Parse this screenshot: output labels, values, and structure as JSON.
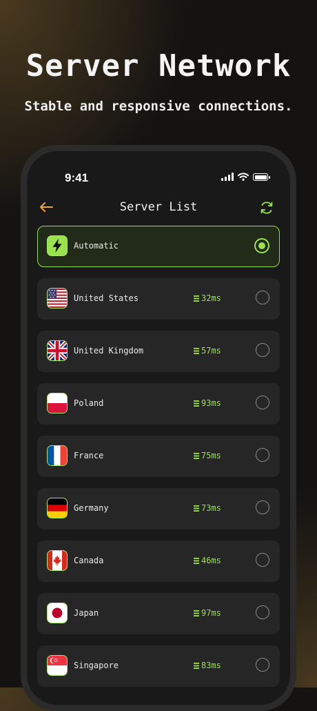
{
  "hero": {
    "title": "Server Network",
    "subtitle": "Stable and responsive connections."
  },
  "status_bar": {
    "time": "9:41"
  },
  "nav": {
    "title": "Server List",
    "back_icon": "arrow-left-icon",
    "refresh_icon": "refresh-icon"
  },
  "colors": {
    "accent": "#9be24f",
    "back_arrow": "#f2a33a",
    "row_bg": "#262626",
    "screen_bg": "#191919"
  },
  "servers": [
    {
      "name": "Automatic",
      "ping": "",
      "selected": true,
      "icon": "lightning-icon"
    },
    {
      "name": "United States",
      "ping": "32ms",
      "selected": false,
      "icon": "us-flag-icon"
    },
    {
      "name": "United Kingdom",
      "ping": "57ms",
      "selected": false,
      "icon": "uk-flag-icon"
    },
    {
      "name": "Poland",
      "ping": "93ms",
      "selected": false,
      "icon": "poland-flag-icon"
    },
    {
      "name": "France",
      "ping": "75ms",
      "selected": false,
      "icon": "france-flag-icon"
    },
    {
      "name": "Germany",
      "ping": "73ms",
      "selected": false,
      "icon": "germany-flag-icon"
    },
    {
      "name": "Canada",
      "ping": "46ms",
      "selected": false,
      "icon": "canada-flag-icon"
    },
    {
      "name": "Japan",
      "ping": "97ms",
      "selected": false,
      "icon": "japan-flag-icon"
    },
    {
      "name": "Singapore",
      "ping": "83ms",
      "selected": false,
      "icon": "singapore-flag-icon"
    }
  ]
}
